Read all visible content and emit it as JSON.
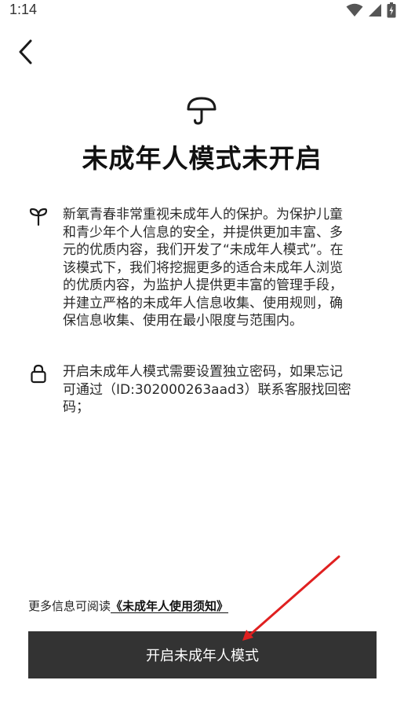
{
  "status_bar": {
    "time": "1:14",
    "icons": [
      "wifi-icon",
      "cellular-signal-icon",
      "battery-charging-icon"
    ]
  },
  "nav": {
    "back_icon": "chevron-left-icon"
  },
  "hero": {
    "icon": "umbrella-icon",
    "title": "未成年人模式未开启"
  },
  "info": [
    {
      "icon": "sprout-icon",
      "text": "新氧青春非常重视未成年人的保护。为保护儿童\n和青少年个人信息的安全，并提供更加丰富、多\n元的优质内容，我们开发了“未成年人模式”。在\n该模式下，我们将挖掘更多的适合未成年人浏览\n的优质内容，为监护人提供更丰富的管理手段，\n并建立严格的未成年人信息收集、使用规则，确\n保信息收集、使用在最小限度与范围内。"
    },
    {
      "icon": "lock-icon",
      "text": "开启未成年人模式需要设置独立密码，如果忘记\n可通过（ID:302000263aad3）联系客服找回密\n码；"
    }
  ],
  "footer": {
    "prefix": "更多信息可阅读",
    "link": "《未成年人使用须知》"
  },
  "primary_button": {
    "label": "开启未成年人模式"
  },
  "colors": {
    "button_bg": "#333333",
    "button_text": "#ffffff",
    "annotation_arrow": "#e02020"
  }
}
